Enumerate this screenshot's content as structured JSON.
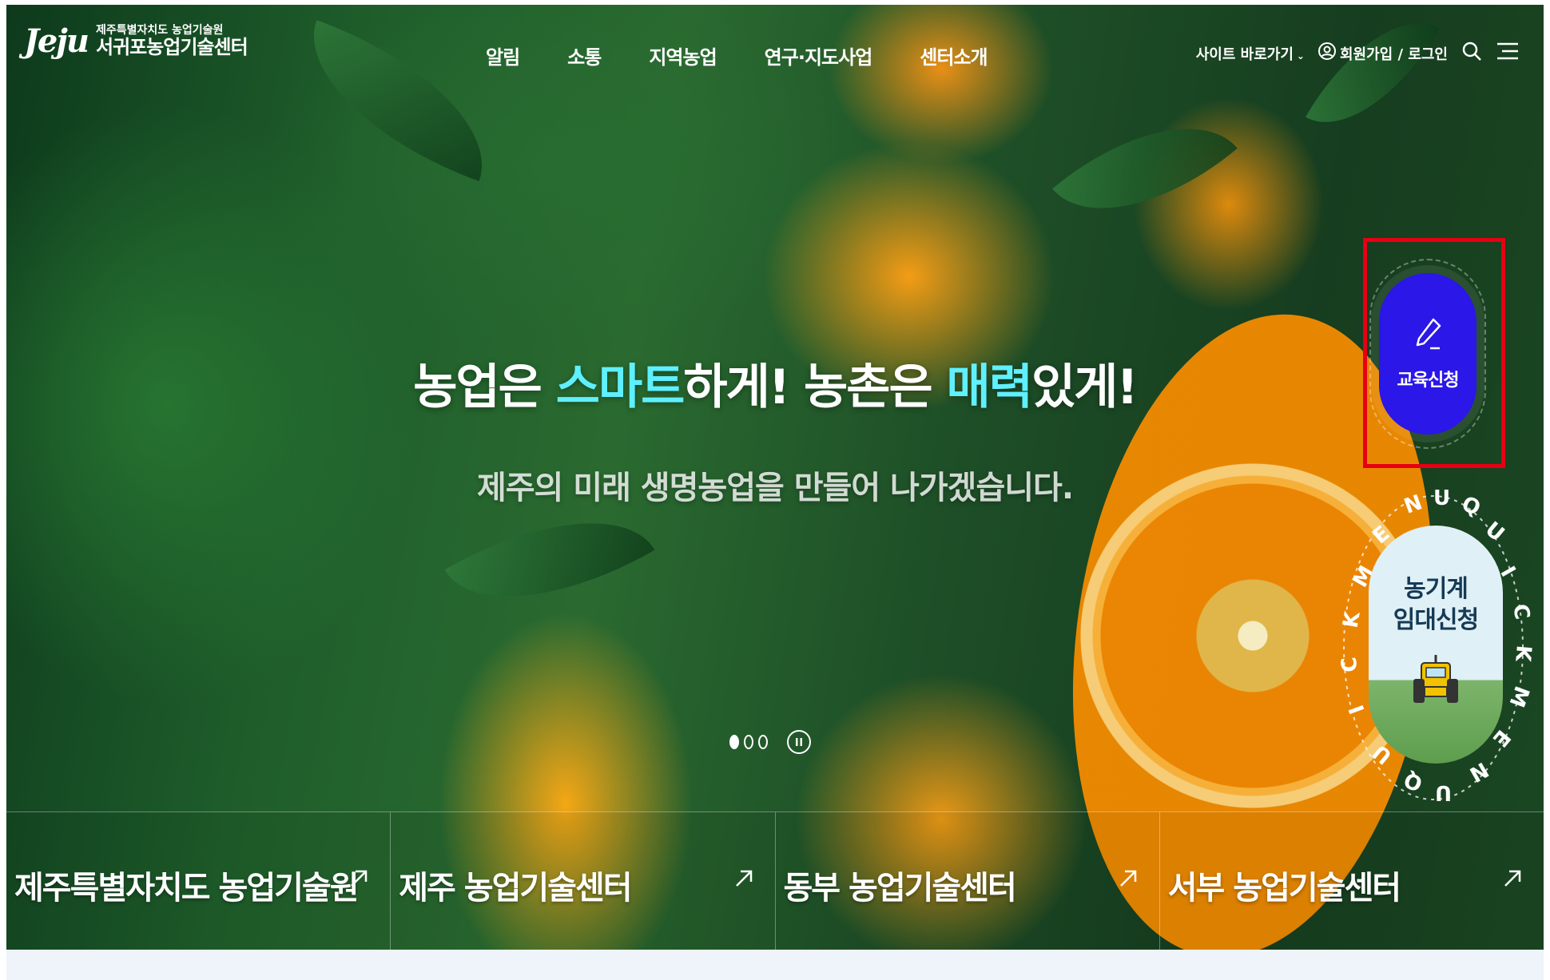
{
  "header": {
    "logo_mark": "Jeju",
    "logo_sub": "제주특별자치도 농업기술원",
    "logo_main": "서귀포농업기술센터",
    "nav": [
      "알림",
      "소통",
      "지역농업",
      "연구·지도사업",
      "센터소개"
    ],
    "site_shortcut": "사이트 바로가기",
    "login": "회원가입 / 로그인"
  },
  "hero": {
    "title_part1": "농업은 ",
    "title_smart": "스마트",
    "title_part2": "하게! 농촌은 ",
    "title_charm": "매력",
    "title_part3": "있게!",
    "subtitle": "제주의 미래 생명농업을 만들어 나가겠습니다."
  },
  "slider": {
    "total_slides": 3,
    "active_slide": 1
  },
  "quick": {
    "edu_label": "교육신청",
    "rental_line1": "농기계",
    "rental_line2": "임대신청",
    "ring_text": "QUICK MENU QUICK MENU"
  },
  "bottom_links": [
    {
      "label": "제주특별자치도 농업기술원"
    },
    {
      "label": "제주 농업기술센터"
    },
    {
      "label": "동부 농업기술센터"
    },
    {
      "label": "서부 농업기술센터"
    }
  ],
  "colors": {
    "accent_cyan": "#5ff0ff",
    "edu_button": "#2a17e8",
    "highlight": "#e60012"
  }
}
